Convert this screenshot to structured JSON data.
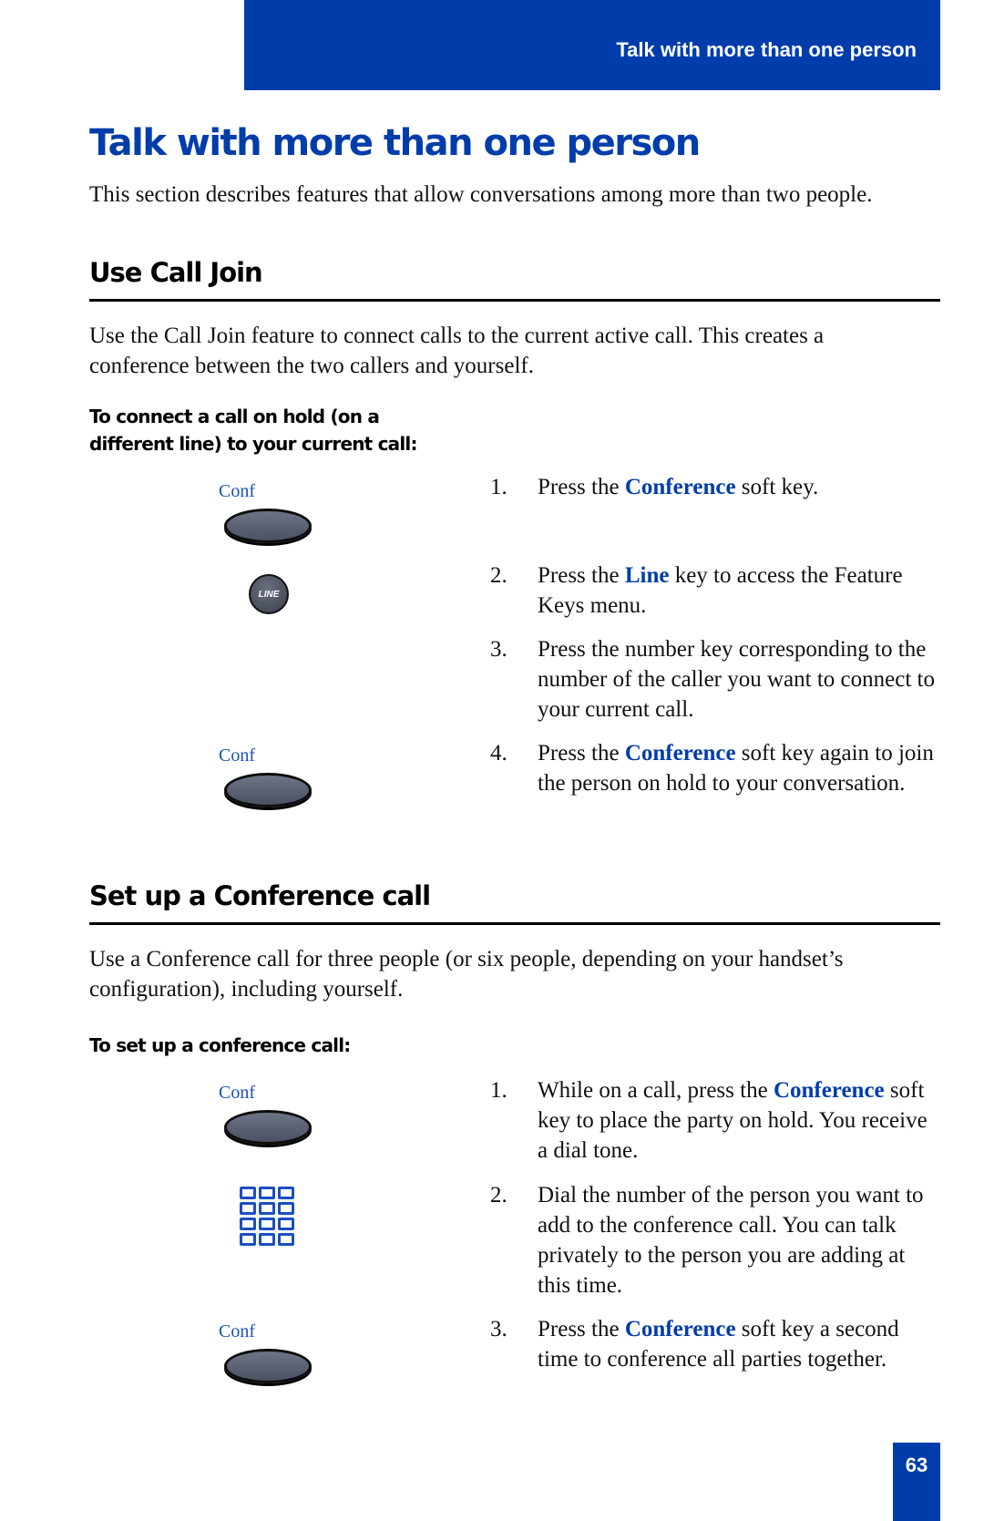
{
  "header": {
    "running_title": "Talk with more than one person"
  },
  "page": {
    "title": "Talk with more than one person",
    "intro": "This section describes features that allow conversations among more than two people.",
    "number": "63"
  },
  "call_join": {
    "heading": "Use Call Join",
    "description": "Use the Call Join feature to connect calls to the current active call. This creates a conference between the two callers and yourself.",
    "procedure_title_line1": "To connect a call on hold (on a",
    "procedure_title_line2": "different line) to your current call:",
    "keys": {
      "conf1": "Conf",
      "line": "LINE",
      "conf2": "Conf"
    },
    "steps": [
      {
        "num": "1.",
        "pre": "Press the ",
        "key": "Conference",
        "post": " soft key."
      },
      {
        "num": "2.",
        "pre": "Press the ",
        "key": "Line",
        "post": " key to access the Feature Keys menu."
      },
      {
        "num": "3.",
        "pre": "Press the number key corresponding to the number of the caller you want to connect to your current call.",
        "key": "",
        "post": ""
      },
      {
        "num": "4.",
        "pre": "Press the ",
        "key": "Conference",
        "post": " soft key again to join the person on hold to your conversation."
      }
    ]
  },
  "conference": {
    "heading": "Set up a Conference call",
    "description": "Use a Conference call for three people (or six people, depending on your handset’s configuration), including yourself.",
    "procedure_title": "To set up a conference call:",
    "keys": {
      "conf1": "Conf",
      "conf2": "Conf"
    },
    "steps": [
      {
        "num": "1.",
        "pre": "While on a call, press the ",
        "key": "Conference",
        "post": " soft key to place the party on hold. You receive a dial tone."
      },
      {
        "num": "2.",
        "pre": "Dial the number of the person you want to add to the conference call. You can talk privately to the person you are adding at this time.",
        "key": "",
        "post": ""
      },
      {
        "num": "3.",
        "pre": "Press the ",
        "key": "Conference",
        "post": " soft key a second time to conference all parties together."
      }
    ]
  },
  "colors": {
    "brand_blue": "#003DAB"
  }
}
